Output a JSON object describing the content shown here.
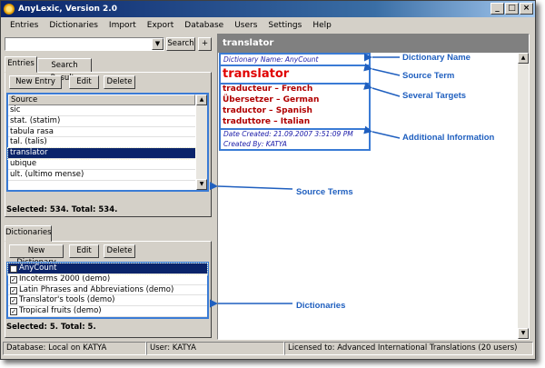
{
  "window": {
    "title": "AnyLexic, Version 2.0"
  },
  "menu": [
    "Entries",
    "Dictionaries",
    "Import",
    "Export",
    "Database",
    "Users",
    "Settings",
    "Help"
  ],
  "search": {
    "value": "",
    "button": "Search",
    "add": "+"
  },
  "entries_tabs": [
    "Entries",
    "Search Results"
  ],
  "entries_toolbar": {
    "new": "New Entry",
    "edit": "Edit",
    "delete": "Delete"
  },
  "source_list": {
    "header": "Source",
    "items": [
      "sic",
      "stat. (statim)",
      "tabula rasa",
      "tal. (talis)",
      "translator",
      "ubique",
      "ult. (ultimo mense)"
    ],
    "selected_index": 4
  },
  "entries_status": "Selected: 534. Total: 534.",
  "dict_tab": "Dictionaries",
  "dict_toolbar": {
    "new": "New Dictionary",
    "edit": "Edit",
    "delete": "Delete"
  },
  "dictionaries": {
    "items": [
      "AnyCount",
      "Incoterms 2000 (demo)",
      "Latin Phrases and Abbreviations (demo)",
      "Translator's tools (demo)",
      "Tropical fruits (demo)"
    ],
    "selected_index": 0
  },
  "dict_status": "Selected: 5. Total: 5.",
  "entry_view": {
    "header": "translator",
    "dictionary_name": "Dictionary Name: AnyCount",
    "term": "translator",
    "targets": [
      "traducteur – French",
      "Übersetzer – German",
      "traductor – Spanish",
      "traduttore – Italian"
    ],
    "date_created": "Date Created: 21.09.2007 3:51:09 PM",
    "created_by": "Created By: KATYA"
  },
  "annotations": {
    "dictionary_name": "Dictionary Name",
    "source_term": "Source Term",
    "several_targets": "Several Targets",
    "additional_info": "Additional Information",
    "source_terms": "Source Terms",
    "dictionaries": "Dictionaries"
  },
  "statusbar": {
    "database": "Database: Local on KATYA",
    "user": "User: KATYA",
    "license": "Licensed to: Advanced International Translations (20 users)"
  },
  "colors": {
    "annotation": "#1f5fbf",
    "term": "#e00000",
    "target": "#b00000",
    "selection": "#0a246a"
  }
}
